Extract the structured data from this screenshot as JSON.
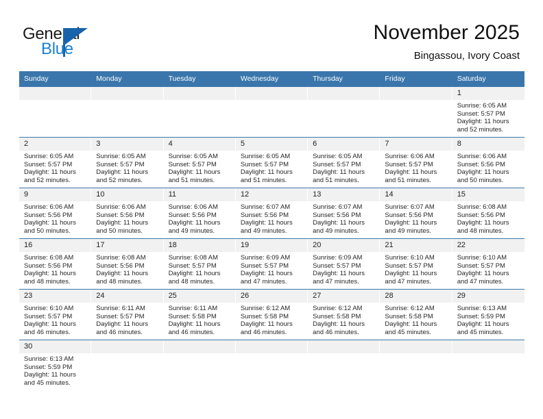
{
  "brand": {
    "word_one": "General",
    "word_two": "Blue",
    "logo_icon": "triangle-flag-icon"
  },
  "header": {
    "month_title": "November 2025",
    "location": "Bingassou, Ivory Coast"
  },
  "calendar": {
    "weekday_headers": [
      "Sunday",
      "Monday",
      "Tuesday",
      "Wednesday",
      "Thursday",
      "Friday",
      "Saturday"
    ],
    "accent_color": "#3a76ab",
    "daynum_background": "#f1f1f1",
    "weeks": [
      [
        {
          "day": "",
          "lines": []
        },
        {
          "day": "",
          "lines": []
        },
        {
          "day": "",
          "lines": []
        },
        {
          "day": "",
          "lines": []
        },
        {
          "day": "",
          "lines": []
        },
        {
          "day": "",
          "lines": []
        },
        {
          "day": "1",
          "lines": [
            "Sunrise: 6:05 AM",
            "Sunset: 5:57 PM",
            "Daylight: 11 hours",
            "and 52 minutes."
          ]
        }
      ],
      [
        {
          "day": "2",
          "lines": [
            "Sunrise: 6:05 AM",
            "Sunset: 5:57 PM",
            "Daylight: 11 hours",
            "and 52 minutes."
          ]
        },
        {
          "day": "3",
          "lines": [
            "Sunrise: 6:05 AM",
            "Sunset: 5:57 PM",
            "Daylight: 11 hours",
            "and 52 minutes."
          ]
        },
        {
          "day": "4",
          "lines": [
            "Sunrise: 6:05 AM",
            "Sunset: 5:57 PM",
            "Daylight: 11 hours",
            "and 51 minutes."
          ]
        },
        {
          "day": "5",
          "lines": [
            "Sunrise: 6:05 AM",
            "Sunset: 5:57 PM",
            "Daylight: 11 hours",
            "and 51 minutes."
          ]
        },
        {
          "day": "6",
          "lines": [
            "Sunrise: 6:05 AM",
            "Sunset: 5:57 PM",
            "Daylight: 11 hours",
            "and 51 minutes."
          ]
        },
        {
          "day": "7",
          "lines": [
            "Sunrise: 6:06 AM",
            "Sunset: 5:57 PM",
            "Daylight: 11 hours",
            "and 51 minutes."
          ]
        },
        {
          "day": "8",
          "lines": [
            "Sunrise: 6:06 AM",
            "Sunset: 5:56 PM",
            "Daylight: 11 hours",
            "and 50 minutes."
          ]
        }
      ],
      [
        {
          "day": "9",
          "lines": [
            "Sunrise: 6:06 AM",
            "Sunset: 5:56 PM",
            "Daylight: 11 hours",
            "and 50 minutes."
          ]
        },
        {
          "day": "10",
          "lines": [
            "Sunrise: 6:06 AM",
            "Sunset: 5:56 PM",
            "Daylight: 11 hours",
            "and 50 minutes."
          ]
        },
        {
          "day": "11",
          "lines": [
            "Sunrise: 6:06 AM",
            "Sunset: 5:56 PM",
            "Daylight: 11 hours",
            "and 49 minutes."
          ]
        },
        {
          "day": "12",
          "lines": [
            "Sunrise: 6:07 AM",
            "Sunset: 5:56 PM",
            "Daylight: 11 hours",
            "and 49 minutes."
          ]
        },
        {
          "day": "13",
          "lines": [
            "Sunrise: 6:07 AM",
            "Sunset: 5:56 PM",
            "Daylight: 11 hours",
            "and 49 minutes."
          ]
        },
        {
          "day": "14",
          "lines": [
            "Sunrise: 6:07 AM",
            "Sunset: 5:56 PM",
            "Daylight: 11 hours",
            "and 49 minutes."
          ]
        },
        {
          "day": "15",
          "lines": [
            "Sunrise: 6:08 AM",
            "Sunset: 5:56 PM",
            "Daylight: 11 hours",
            "and 48 minutes."
          ]
        }
      ],
      [
        {
          "day": "16",
          "lines": [
            "Sunrise: 6:08 AM",
            "Sunset: 5:56 PM",
            "Daylight: 11 hours",
            "and 48 minutes."
          ]
        },
        {
          "day": "17",
          "lines": [
            "Sunrise: 6:08 AM",
            "Sunset: 5:56 PM",
            "Daylight: 11 hours",
            "and 48 minutes."
          ]
        },
        {
          "day": "18",
          "lines": [
            "Sunrise: 6:08 AM",
            "Sunset: 5:57 PM",
            "Daylight: 11 hours",
            "and 48 minutes."
          ]
        },
        {
          "day": "19",
          "lines": [
            "Sunrise: 6:09 AM",
            "Sunset: 5:57 PM",
            "Daylight: 11 hours",
            "and 47 minutes."
          ]
        },
        {
          "day": "20",
          "lines": [
            "Sunrise: 6:09 AM",
            "Sunset: 5:57 PM",
            "Daylight: 11 hours",
            "and 47 minutes."
          ]
        },
        {
          "day": "21",
          "lines": [
            "Sunrise: 6:10 AM",
            "Sunset: 5:57 PM",
            "Daylight: 11 hours",
            "and 47 minutes."
          ]
        },
        {
          "day": "22",
          "lines": [
            "Sunrise: 6:10 AM",
            "Sunset: 5:57 PM",
            "Daylight: 11 hours",
            "and 47 minutes."
          ]
        }
      ],
      [
        {
          "day": "23",
          "lines": [
            "Sunrise: 6:10 AM",
            "Sunset: 5:57 PM",
            "Daylight: 11 hours",
            "and 46 minutes."
          ]
        },
        {
          "day": "24",
          "lines": [
            "Sunrise: 6:11 AM",
            "Sunset: 5:57 PM",
            "Daylight: 11 hours",
            "and 46 minutes."
          ]
        },
        {
          "day": "25",
          "lines": [
            "Sunrise: 6:11 AM",
            "Sunset: 5:58 PM",
            "Daylight: 11 hours",
            "and 46 minutes."
          ]
        },
        {
          "day": "26",
          "lines": [
            "Sunrise: 6:12 AM",
            "Sunset: 5:58 PM",
            "Daylight: 11 hours",
            "and 46 minutes."
          ]
        },
        {
          "day": "27",
          "lines": [
            "Sunrise: 6:12 AM",
            "Sunset: 5:58 PM",
            "Daylight: 11 hours",
            "and 46 minutes."
          ]
        },
        {
          "day": "28",
          "lines": [
            "Sunrise: 6:12 AM",
            "Sunset: 5:58 PM",
            "Daylight: 11 hours",
            "and 45 minutes."
          ]
        },
        {
          "day": "29",
          "lines": [
            "Sunrise: 6:13 AM",
            "Sunset: 5:59 PM",
            "Daylight: 11 hours",
            "and 45 minutes."
          ]
        }
      ],
      [
        {
          "day": "30",
          "lines": [
            "Sunrise: 6:13 AM",
            "Sunset: 5:59 PM",
            "Daylight: 11 hours",
            "and 45 minutes."
          ]
        },
        {
          "day": "",
          "lines": []
        },
        {
          "day": "",
          "lines": []
        },
        {
          "day": "",
          "lines": []
        },
        {
          "day": "",
          "lines": []
        },
        {
          "day": "",
          "lines": []
        },
        {
          "day": "",
          "lines": []
        }
      ]
    ]
  }
}
